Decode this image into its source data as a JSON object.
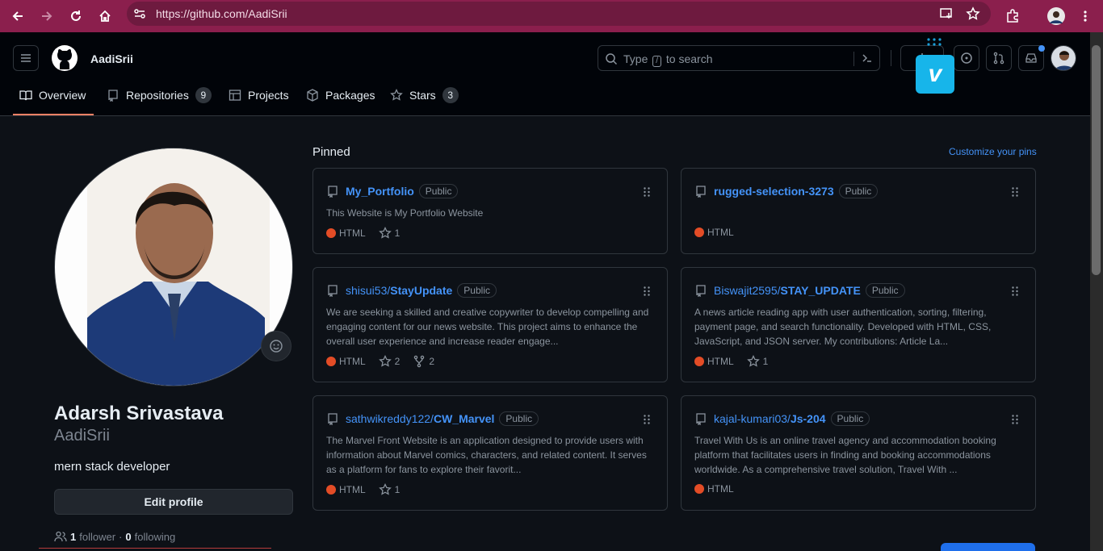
{
  "browser": {
    "url": "https://github.com/AadiSrii",
    "colors": {
      "toolbar": "#8b1f4d"
    }
  },
  "header": {
    "username": "AadiSrii",
    "search_placeholder_before": "Type",
    "search_key": "/",
    "search_placeholder_after": "to search"
  },
  "tabs": [
    {
      "label": "Overview",
      "icon": "book-icon",
      "selected": true
    },
    {
      "label": "Repositories",
      "icon": "repo-icon",
      "count": "9"
    },
    {
      "label": "Projects",
      "icon": "table-icon"
    },
    {
      "label": "Packages",
      "icon": "package-icon"
    },
    {
      "label": "Stars",
      "icon": "star-icon",
      "count": "3"
    }
  ],
  "profile": {
    "full_name": "Adarsh Srivastava",
    "login": "AadiSrii",
    "bio": "mern stack developer",
    "edit_label": "Edit profile",
    "followers": "1",
    "followers_label": "follower",
    "following": "0",
    "following_label": "following",
    "separator": "·"
  },
  "pinned": {
    "title": "Pinned",
    "customize_label": "Customize your pins",
    "language_color": "#e34c26",
    "cards": [
      {
        "owner": "",
        "name": "My_Portfolio",
        "visibility": "Public",
        "description": "This Website is My Portfolio Website",
        "language": "HTML",
        "stars": "1",
        "forks": ""
      },
      {
        "owner": "",
        "name": "rugged-selection-3273",
        "visibility": "Public",
        "description": "",
        "language": "HTML",
        "stars": "",
        "forks": ""
      },
      {
        "owner": "shisui53/",
        "name": "StayUpdate",
        "visibility": "Public",
        "description": "We are seeking a skilled and creative copywriter to develop compelling and engaging content for our news website. This project aims to enhance the overall user experience and increase reader engage...",
        "language": "HTML",
        "stars": "2",
        "forks": "2"
      },
      {
        "owner": "Biswajit2595/",
        "name": "STAY_UPDATE",
        "visibility": "Public",
        "description": "A news article reading app with user authentication, sorting, filtering, payment page, and search functionality. Developed with HTML, CSS, JavaScript, and JSON server. My contributions: Article La...",
        "language": "HTML",
        "stars": "1",
        "forks": ""
      },
      {
        "owner": "sathwikreddy122/",
        "name": "CW_Marvel",
        "visibility": "Public",
        "description": "The Marvel Front Website is an application designed to provide users with information about Marvel comics, characters, and related content. It serves as a platform for fans to explore their favorit...",
        "language": "HTML",
        "stars": "1",
        "forks": ""
      },
      {
        "owner": "kajal-kumari03/",
        "name": "Js-204",
        "visibility": "Public",
        "description": "Travel With Us is an online travel agency and accommodation booking platform that facilitates users in finding and booking accommodations worldwide. As a comprehensive travel solution, Travel With ...",
        "language": "HTML",
        "stars": "",
        "forks": ""
      }
    ]
  },
  "overlay": {
    "icon": "vimeo-icon",
    "letter": "v",
    "color": "#17b5ea"
  }
}
